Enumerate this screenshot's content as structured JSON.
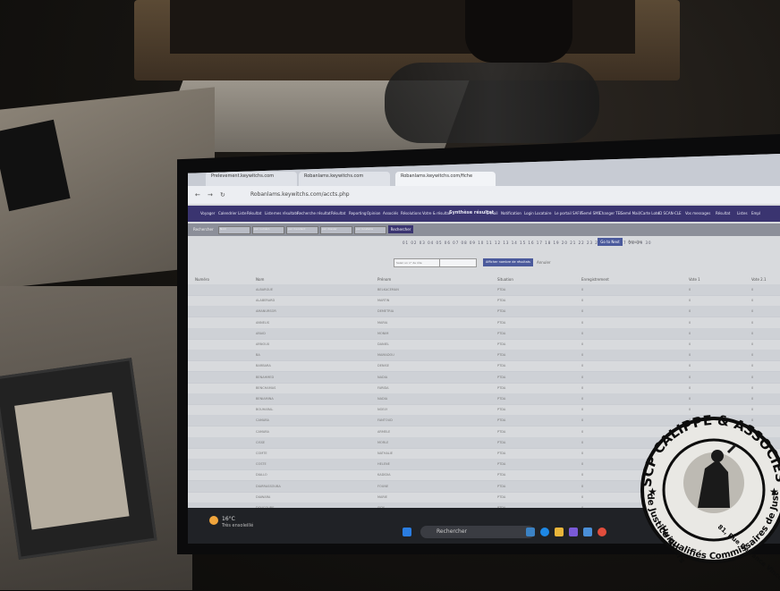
{
  "browser": {
    "tabs": [
      {
        "label": "Prelevement.keywitchs.com"
      },
      {
        "label": "Robanlams.keywitchs.com"
      },
      {
        "label": "Robanlams.keywitchs.com/fiche"
      }
    ],
    "url": "Robanlams.keywitchs.com/accts.php"
  },
  "menu": {
    "items": [
      "Voyager",
      "Calendrier",
      "Liste",
      "Résultat",
      "Liste",
      "mes résultats",
      "Recherche résultat",
      "Résultat",
      "Reporting",
      "Opinion",
      "Associés",
      "Résolutions",
      "Votre & résultat",
      "Synthèse résultat",
      "E-mail",
      "Notification",
      "Login",
      "Locataire",
      "Le portail SAFIF",
      "Semé SMS",
      "Changer TEL",
      "Semé Mail/Carte Lote",
      "ID SCAN-CLE",
      "Vos messages",
      "Résultat",
      "Listes",
      "Empl"
    ]
  },
  "search": {
    "label": "Rechercher",
    "placeholders": [
      "Nom",
      "par numéro",
      "par mandant",
      "par dossier",
      "par locataire"
    ],
    "button": "Rechercher"
  },
  "pager": {
    "pages": "01 02 03 04 05 06 07 08 09 10 11 12 13 14 15 16 17 18 19 20 21 22 23 24 25 26 27 28 29 30",
    "button": "Go to Next",
    "link": "Annuler"
  },
  "filter": {
    "placeholder": "Saisir un n° de rôle",
    "button": "Afficher nombre de résultats",
    "link": "Annuler"
  },
  "table": {
    "headers": [
      "Numéro",
      "Nom",
      "Prénom",
      "Situation",
      "Enregistrement",
      "Vote 1",
      "Vote 2.1"
    ],
    "rows": [
      {
        "nom": "ALBARGUE",
        "prenom": "BELKACEMAN",
        "situation": "PTDA",
        "enr": "0",
        "v1": "0",
        "v2": "0"
      },
      {
        "nom": "ALABERARD",
        "prenom": "MARTIN",
        "situation": "PTDA",
        "enr": "0",
        "v1": "0",
        "v2": "0"
      },
      {
        "nom": "AMANURSOR",
        "prenom": "DEMETRIA",
        "situation": "PTDA",
        "enr": "0",
        "v1": "0",
        "v2": "0"
      },
      {
        "nom": "ANNELIS",
        "prenom": "MARIA",
        "situation": "PTDA",
        "enr": "0",
        "v1": "0",
        "v2": "0"
      },
      {
        "nom": "ARAID",
        "prenom": "MONIM",
        "situation": "PTDA",
        "enr": "0",
        "v1": "0",
        "v2": "0"
      },
      {
        "nom": "ARNOUX",
        "prenom": "DANIEL",
        "situation": "PTDA",
        "enr": "0",
        "v1": "0",
        "v2": "0"
      },
      {
        "nom": "BA",
        "prenom": "MAMADOU",
        "situation": "PTDA",
        "enr": "0",
        "v1": "0",
        "v2": "0"
      },
      {
        "nom": "BARBARA",
        "prenom": "DENISE",
        "situation": "PTDA",
        "enr": "0",
        "v1": "0",
        "v2": "0"
      },
      {
        "nom": "BENAHMED",
        "prenom": "NADIA",
        "situation": "PTDA",
        "enr": "0",
        "v1": "0",
        "v2": "0"
      },
      {
        "nom": "BENCHAMAS",
        "prenom": "FARIDA",
        "situation": "PTDA",
        "enr": "0",
        "v1": "0",
        "v2": "0"
      },
      {
        "nom": "BENIAMINA",
        "prenom": "NADIA",
        "situation": "PTDA",
        "enr": "0",
        "v1": "0",
        "v2": "0"
      },
      {
        "nom": "BOUHARAL",
        "prenom": "NOELY",
        "situation": "PTDA",
        "enr": "0",
        "v1": "0",
        "v2": "0"
      },
      {
        "nom": "CAMARA",
        "prenom": "FANTOUD",
        "situation": "PTDA",
        "enr": "0",
        "v1": "0",
        "v2": "0"
      },
      {
        "nom": "CAMARA",
        "prenom": "ARMELE",
        "situation": "PTDA",
        "enr": "0",
        "v1": "0",
        "v2": "0"
      },
      {
        "nom": "CISSE",
        "prenom": "MORLE",
        "situation": "PTDA",
        "enr": "0",
        "v1": "0",
        "v2": "0"
      },
      {
        "nom": "COMTE",
        "prenom": "NATHALIE",
        "situation": "PTDA",
        "enr": "0",
        "v1": "0",
        "v2": "0"
      },
      {
        "nom": "COSTE",
        "prenom": "HELENE",
        "situation": "PTDA",
        "enr": "0",
        "v1": "0",
        "v2": "0"
      },
      {
        "nom": "DIALLO",
        "prenom": "KADIDIA",
        "situation": "PTDA",
        "enr": "0",
        "v1": "0",
        "v2": "0"
      },
      {
        "nom": "DIARRASSOUBA",
        "prenom": "FOUNE",
        "situation": "PTDA",
        "enr": "0",
        "v1": "0",
        "v2": "0"
      },
      {
        "nom": "DIAWARA",
        "prenom": "MARIE",
        "situation": "PTDA",
        "enr": "0",
        "v1": "0",
        "v2": "0"
      },
      {
        "nom": "DOUCOURE",
        "prenom": "SIDY",
        "situation": "PTDA",
        "enr": "0",
        "v1": "0",
        "v2": "0"
      },
      {
        "nom": "DOUCOURE",
        "prenom": "MOUSSA",
        "situation": "PTDA",
        "enr": "0",
        "v1": "0",
        "v2": "0"
      },
      {
        "nom": "FOFANA",
        "prenom": "KASSI",
        "situation": "PTDA",
        "enr": "0",
        "v1": "0",
        "v2": "0"
      }
    ]
  },
  "taskbar": {
    "temp": "16°C",
    "weather": "Très ensoleillé",
    "search": "Rechercher"
  },
  "stamp": {
    "top": "SCP CALIPPE & ASSOCIES",
    "left": "Huissiers",
    "bottom": "de Justice qualifiés Commissaires de Justice",
    "address": "81, Rue Defrance Vincennes"
  }
}
